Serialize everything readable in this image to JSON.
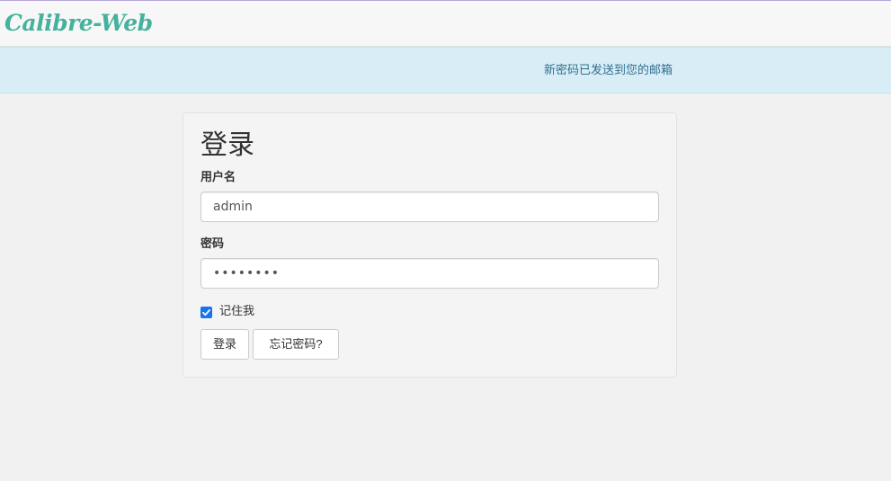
{
  "navbar": {
    "brand": "Calibre-Web"
  },
  "alert": {
    "message": "新密码已发送到您的邮箱"
  },
  "login": {
    "title": "登录",
    "username_label": "用户名",
    "username_value": "admin",
    "password_label": "密码",
    "password_value": "••••••••",
    "remember_label": "记住我",
    "remember_checked": true,
    "submit_label": "登录",
    "forgot_label": "忘记密码?"
  },
  "colors": {
    "brand": "#45b29d",
    "alert_bg": "#d9edf7",
    "alert_text": "#31708f",
    "checkbox": "#1a73e8"
  }
}
